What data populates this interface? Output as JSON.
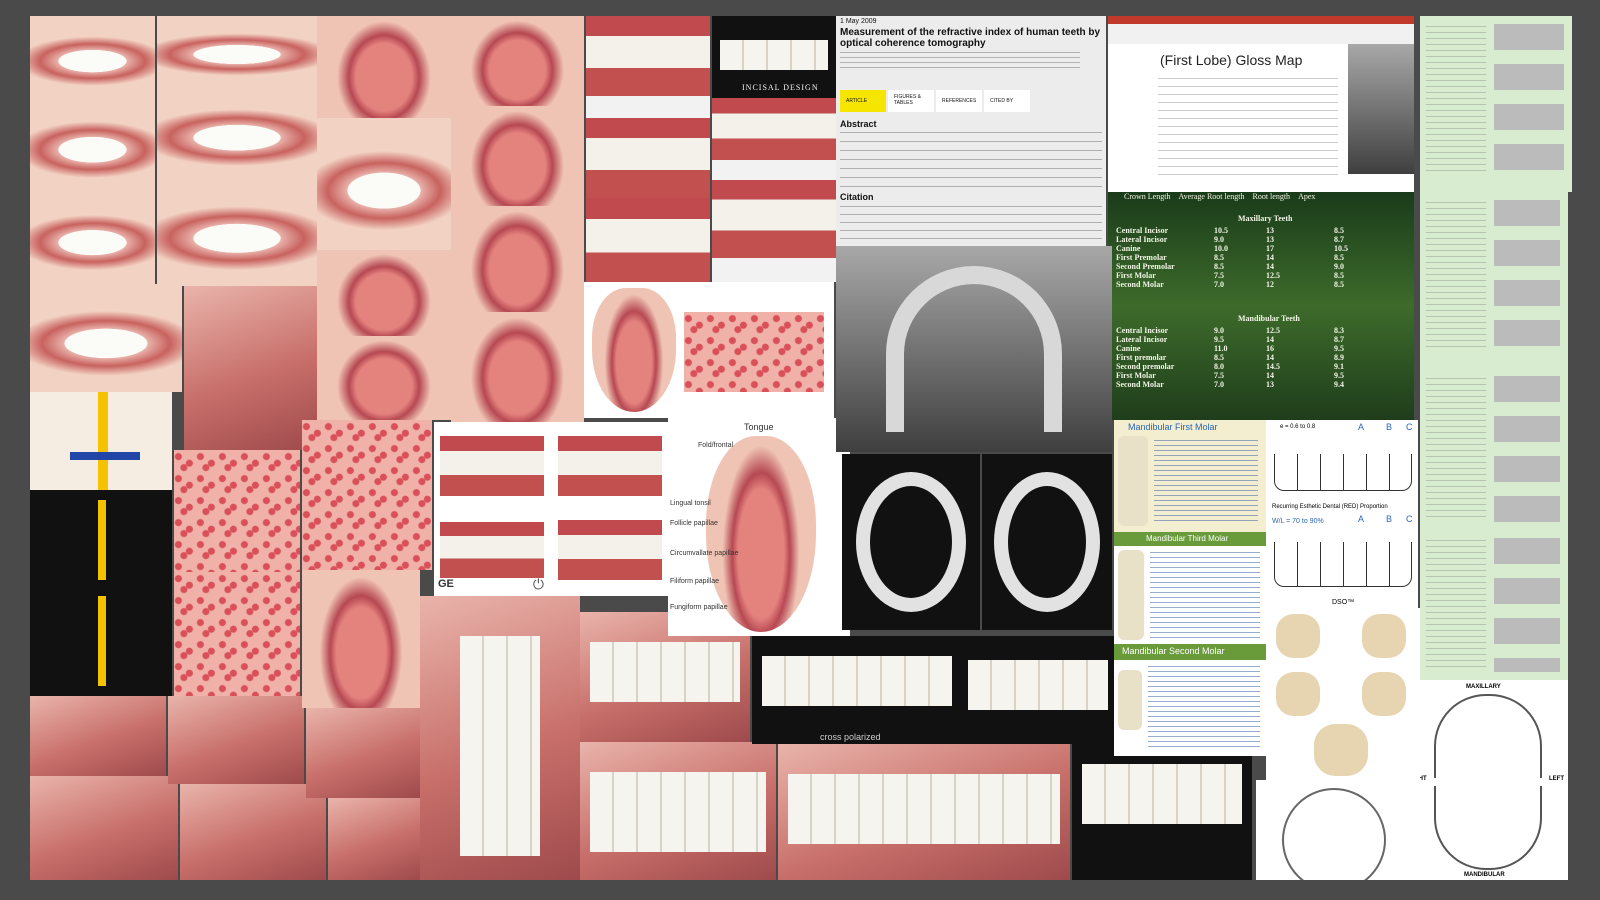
{
  "article": {
    "date": "1 May 2009",
    "title": "Measurement of the refractive index of human teeth by optical coherence tomography",
    "tabs": [
      "ARTICLE",
      "FIGURES & TABLES",
      "REFERENCES",
      "CITED BY"
    ],
    "abstract_heading": "Abstract",
    "citation_heading": "Citation"
  },
  "gloss_map": {
    "title": "(First Lobe) Gloss Map"
  },
  "tooth_table": {
    "headers": [
      "Crown Length",
      "Average Root length",
      "Root length",
      "Apex"
    ],
    "maxillary_heading": "Maxillary Teeth",
    "mandibular_heading": "Mandibular Teeth",
    "maxillary_rows": [
      [
        "Central Incisor",
        "10.5",
        "13",
        "8.5"
      ],
      [
        "Lateral Incisor",
        "9.0",
        "13",
        "8.7"
      ],
      [
        "Canine",
        "10.0",
        "17",
        "10.5"
      ],
      [
        "First Premolar",
        "8.5",
        "14",
        "8.5"
      ],
      [
        "Second Premolar",
        "8.5",
        "14",
        "9.0"
      ],
      [
        "First Molar",
        "7.5",
        "12.5",
        "8.5"
      ],
      [
        "Second Molar",
        "7.0",
        "12",
        "8.5"
      ]
    ],
    "mandibular_rows": [
      [
        "Central Incisor",
        "9.0",
        "12.5",
        "8.3"
      ],
      [
        "Lateral Incisor",
        "9.5",
        "14",
        "8.7"
      ],
      [
        "Canine",
        "11.0",
        "16",
        "9.5"
      ],
      [
        "First premolar",
        "8.5",
        "14",
        "8.9"
      ],
      [
        "Second premolar",
        "8.0",
        "14.5",
        "9.1"
      ],
      [
        "First Molar",
        "7.5",
        "14",
        "9.5"
      ],
      [
        "Second Molar",
        "7.0",
        "13",
        "9.4"
      ]
    ]
  },
  "labels": {
    "incisal_design": "INCISAL DESIGN",
    "tongue_title": "Tongue",
    "tongue_parts": [
      "Fold/frontal",
      "Lingual tonsil",
      "Follicle papillae",
      "Circumvallate papillae",
      "Filiform papillae",
      "Fungiform papillae"
    ],
    "cross_polarized": "cross polarized",
    "mandibular_first_molar": "Mandibular First Molar",
    "mandibular_third_molar": "Mandibular Third Molar",
    "mandibular_second_molar": "Mandibular Second Molar",
    "red_proportion": "Recurring Esthetic Dental (RED) Proportion",
    "red_range": "e = 0.6 to 0.8",
    "wl_label": "W/L = 70 to 90%",
    "dso_label": "DSO™",
    "abc": [
      "A",
      "B",
      "C"
    ],
    "maxillary": "MAXILLARY",
    "mandibular": "MANDIBULAR",
    "right": "RIGHT",
    "left": "LEFT",
    "ge": "GE"
  },
  "colors": {
    "background": "#4a4a4a",
    "accent_yellow": "#f5e500",
    "green_table": "#2e5a23"
  }
}
